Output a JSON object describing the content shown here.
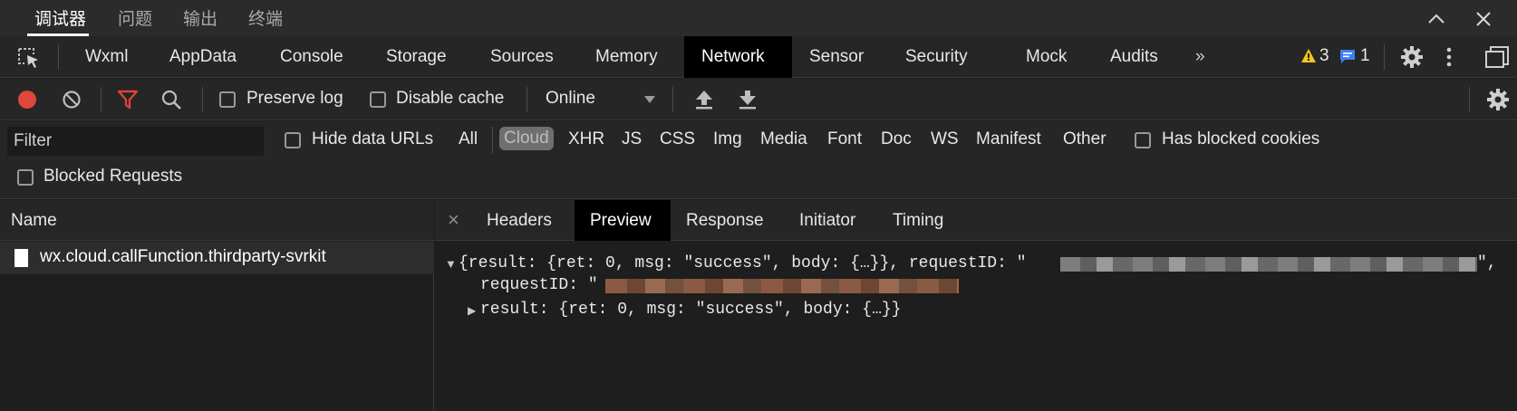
{
  "panel_tabs": [
    "调试器",
    "问题",
    "输出",
    "终端"
  ],
  "devtools_tabs": [
    "Wxml",
    "AppData",
    "Console",
    "Storage",
    "Sources",
    "Memory",
    "Network",
    "Sensor",
    "Security",
    "Mock",
    "Audits"
  ],
  "active_tab": "Network",
  "more_tabs_icon": "»",
  "warnings_count": "3",
  "messages_count": "1",
  "toolbar": {
    "preserve_log": "Preserve log",
    "disable_cache": "Disable cache",
    "throttle": "Online"
  },
  "filter": {
    "placeholder": "Filter",
    "hide_data_urls": "Hide data URLs",
    "types": [
      "All",
      "Cloud",
      "XHR",
      "JS",
      "CSS",
      "Img",
      "Media",
      "Font",
      "Doc",
      "WS",
      "Manifest",
      "Other"
    ],
    "active_type": "Cloud",
    "has_blocked_cookies": "Has blocked cookies",
    "blocked_requests": "Blocked Requests"
  },
  "requests": {
    "header": "Name",
    "items": [
      "wx.cloud.callFunction.thirdparty-svrkit"
    ]
  },
  "detail": {
    "close": "×",
    "tabs": [
      "Headers",
      "Preview",
      "Response",
      "Initiator",
      "Timing"
    ],
    "active_tab": "Preview",
    "preview": {
      "summary": "{result: {ret: 0, msg: \"success\", body: {…}}, requestID: \"",
      "summary_end": "\",",
      "request_id_line": "requestID: \"",
      "result_line": "result: {ret: 0, msg: \"success\", body: {…}}"
    }
  },
  "colors": {
    "record": "#e0453e",
    "filter_active": "#e0453e",
    "warning": "#f5c518",
    "message": "#3d7ff5"
  }
}
